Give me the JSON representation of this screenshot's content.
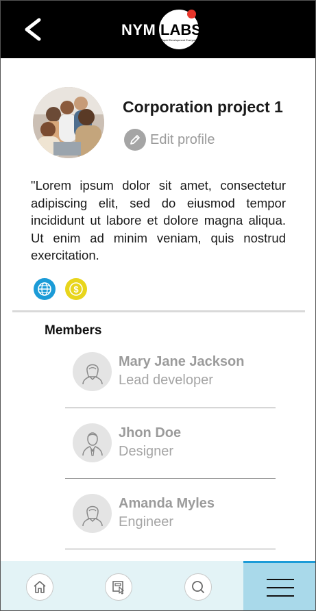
{
  "header": {
    "back_icon": "chevron-left-icon",
    "logo": {
      "left": "NYM",
      "right": "LABS",
      "tagline": "Rapid Development Everywhere"
    },
    "colors": {
      "background": "#000000",
      "accent_dot": "#e8352a"
    }
  },
  "profile": {
    "title": "Corporation project 1",
    "edit_label": "Edit profile",
    "description": "\"Lorem ipsum dolor sit amet, consectetur adipiscing elit, sed do eiusmod tempor incididunt ut labore et dolore magna aliqua. Ut enim ad minim veniam, quis nostrud exercitation.",
    "links": [
      {
        "icon": "globe-icon",
        "color": "#1b9bd7"
      },
      {
        "icon": "dollar-coin-icon",
        "color": "#e8d51c"
      }
    ]
  },
  "members": {
    "heading": "Members",
    "items": [
      {
        "name": "Mary Jane Jackson",
        "role": "Lead developer",
        "avatar_icon": "woman-avatar-icon"
      },
      {
        "name": "Jhon Doe",
        "role": "Designer",
        "avatar_icon": "man-avatar-icon"
      },
      {
        "name": "Amanda Myles",
        "role": "Engineer",
        "avatar_icon": "woman-avatar-icon"
      }
    ]
  },
  "bottom_nav": {
    "items": [
      {
        "icon": "home-icon"
      },
      {
        "icon": "board-cursor-icon"
      },
      {
        "icon": "search-icon"
      },
      {
        "icon": "hamburger-menu-icon",
        "active": true
      }
    ],
    "colors": {
      "bar": "#e3f3f6",
      "active": "#a9d9ea",
      "active_border": "#1c9bd7"
    }
  }
}
